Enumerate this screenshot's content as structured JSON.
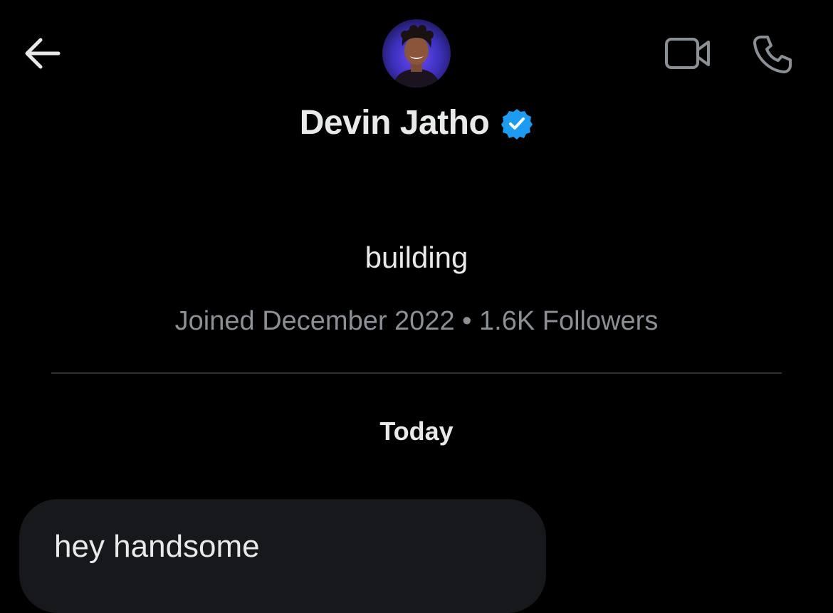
{
  "header": {
    "back_icon": "arrow-left-icon",
    "video_icon": "video-camera-icon",
    "call_icon": "phone-icon",
    "name": "Devin Jatho",
    "verified_icon": "verified-badge-icon"
  },
  "profile": {
    "bio": "building",
    "meta": "Joined December 2022 • 1.6K Followers"
  },
  "conversation": {
    "date_separator": "Today",
    "messages": [
      {
        "text": "hey handsome",
        "direction": "incoming"
      }
    ]
  },
  "colors": {
    "background": "#000000",
    "text_primary": "#e7e9ea",
    "text_secondary": "#8b9096",
    "divider": "#2f3336",
    "bubble_incoming": "#16181c",
    "verified_blue": "#1d9bf0"
  }
}
